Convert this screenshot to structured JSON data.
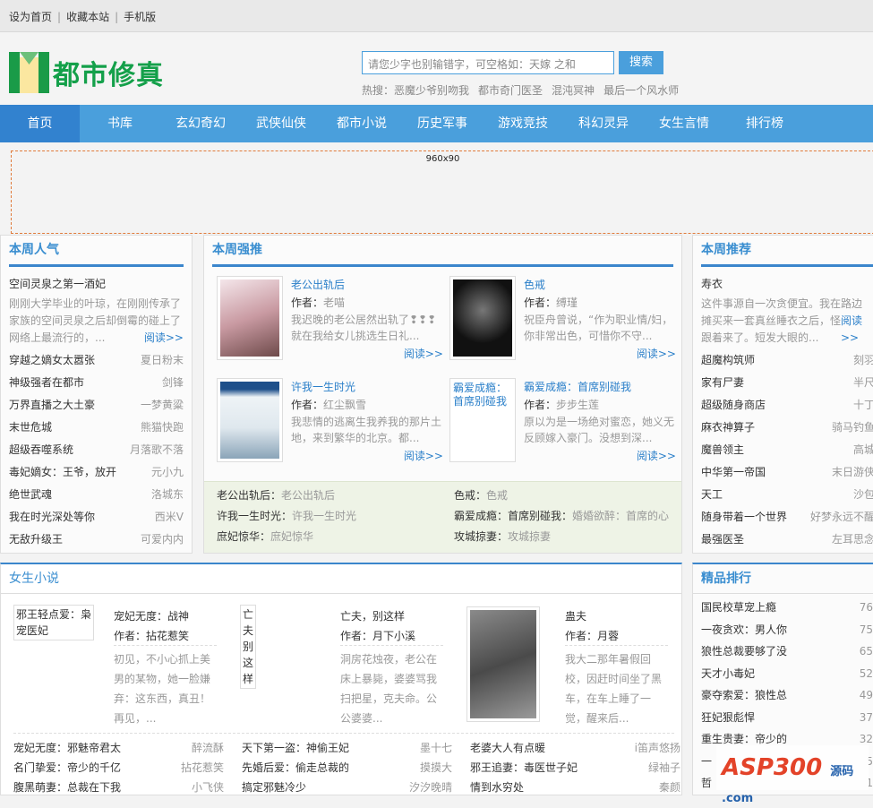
{
  "topbar": {
    "links": [
      "设为首页",
      "收藏本站",
      "手机版"
    ]
  },
  "header": {
    "logo_text": "都市修真",
    "search_placeholder": "请您少字也别输错字，可空格如：天嫁 之和",
    "search_button": "搜索",
    "hot_label": "热搜：",
    "hot": [
      "恶魔少爷别吻我",
      "都市奇门医圣",
      "混沌冥神",
      "最后一个风水师"
    ]
  },
  "nav": [
    "首页",
    "书库",
    "玄幻奇幻",
    "武侠仙侠",
    "都市小说",
    "历史军事",
    "游戏竞技",
    "科幻灵异",
    "女生言情",
    "排行榜"
  ],
  "ad": {
    "label": "960x90"
  },
  "weekly_popular": {
    "title": "本周人气",
    "featured": {
      "title": "空间灵泉之第一酒妃",
      "desc": "刚刚大学毕业的叶琼，在刚刚传承了家族的空间灵泉之后却倒霉的碰上了网络上最流行的，...",
      "more": "阅读>>"
    },
    "items": [
      [
        "穿越之嫡女太嚣张",
        "夏日粉末"
      ],
      [
        "神级强者在都市",
        "剑锋"
      ],
      [
        "万界直播之大土豪",
        "一梦黄粱"
      ],
      [
        "末世危城",
        "熊猫快跑"
      ],
      [
        "超级吞噬系统",
        "月落歌不落"
      ],
      [
        "毒妃嫡女：王爷，放开",
        "元小九"
      ],
      [
        "绝世武魂",
        "洛城东"
      ],
      [
        "我在时光深处等你",
        "西米V"
      ],
      [
        "无敌升级王",
        "可爱内内"
      ]
    ]
  },
  "weekly_push": {
    "title": "本周强推",
    "author_label": "作者：",
    "more": "阅读>>",
    "books": [
      {
        "title": "老公出轨后",
        "author": "老喵",
        "desc": "我迟晚的老公居然出轨了❢❢❢就在我给女儿挑选生日礼..."
      },
      {
        "title": "色戒",
        "author": "缚瑾",
        "desc": "祝臣舟曾说，“作为职业情/妇，你非常出色，可惜你不守..."
      },
      {
        "title": "许我一生时光",
        "author": "红尘飘雪",
        "desc": "我悲情的逃离生我养我的那片土地，来到繁华的北京。都..."
      },
      {
        "title": "霸爱成瘾：首席别碰我",
        "author": "步步生莲",
        "desc": "原以为是一场绝对蜜恋，她义无反顾嫁入豪门。没想到深...",
        "cover_alt": "霸爱成瘾：首席别碰我"
      }
    ],
    "links": [
      [
        "老公出轨后：",
        "老公出轨后"
      ],
      [
        "色戒：",
        "色戒"
      ],
      [
        "许我一生时光：",
        "许我一生时光"
      ],
      [
        "霸爱成瘾：首席别碰我：",
        "婚婚欲醉：首席的心"
      ],
      [
        "庶妃惊华：",
        "庶妃惊华"
      ],
      [
        "攻城掠妻：",
        "攻城掠妻"
      ]
    ]
  },
  "weekly_rec": {
    "title": "本周推荐",
    "featured": {
      "title": "寿衣",
      "desc": "这件事源自一次贪便宜。我在路边摊买来一套真丝睡衣之后，怪事就跟着来了。短发大眼的...",
      "more": "阅读>>"
    },
    "items": [
      [
        "超魔构筑师",
        "刻羽"
      ],
      [
        "家有尸妻",
        "半尺"
      ],
      [
        "超级随身商店",
        "十丁"
      ],
      [
        "麻衣神算子",
        "骑马钓鱼"
      ],
      [
        "魔兽领主",
        "高城"
      ],
      [
        "中华第一帝国",
        "末日游侠"
      ],
      [
        "天工",
        "沙包"
      ],
      [
        "随身带着一个世界",
        "好梦永远不醒"
      ],
      [
        "最强医圣",
        "左耳思念"
      ]
    ]
  },
  "female": {
    "title": "女生小说",
    "author_label": "作者：",
    "featured": [
      {
        "cover_alt": "邪王轻点爱：枭宠医妃",
        "title": "宠妃无度：战神",
        "author": "拈花惹笑",
        "desc": "初见，不小心抓上美男的某物，她一脸嫌弃：这东西，真丑！再见，..."
      },
      {
        "cover_alt": "亡夫别这样",
        "title": "亡夫，别这样",
        "author": "月下小溪",
        "desc": "洞房花烛夜，老公在床上暴毙，婆婆骂我扫把星，克夫命。公公婆婆..."
      },
      {
        "title": "蛊夫",
        "author": "月蓉",
        "desc": "我大二那年暑假回校，因赶时间坐了黑车，在车上睡了一觉，醒来后..."
      }
    ],
    "list": [
      [
        "宠妃无度：邪魅帝君太",
        "醉流酥"
      ],
      [
        "天下第一盗：神偷王妃",
        "墨十七"
      ],
      [
        "老婆大人有点暖",
        "i笛声悠扬"
      ],
      [
        "名门挚爱：帝少的千亿",
        "拈花惹笑"
      ],
      [
        "先婚后爱：偷走总裁的",
        "摸摸大"
      ],
      [
        "邪王追妻：毒医世子妃",
        "绿袖子"
      ],
      [
        "腹黑萌妻：总裁在下我",
        "小飞侠"
      ],
      [
        "搞定邪魅冷少",
        "汐汐晚晴"
      ],
      [
        "情到水穷处",
        "秦颜"
      ]
    ]
  },
  "ranking": {
    "title": "精品排行",
    "items": [
      [
        "国民校草宠上瘾",
        "76"
      ],
      [
        "一夜贪欢：男人你",
        "75"
      ],
      [
        "狼性总裁要够了没",
        "65"
      ],
      [
        "天才小毒妃",
        "52"
      ],
      [
        "豪夺索爱：狼性总",
        "49"
      ],
      [
        "狂妃狠彪悍",
        "37"
      ],
      [
        "重生贵妻：帝少的",
        "32"
      ],
      [
        "一",
        "5"
      ],
      [
        "哲",
        "1"
      ]
    ]
  },
  "watermark": {
    "text": "ASP300",
    "sub": "源码 .com"
  }
}
